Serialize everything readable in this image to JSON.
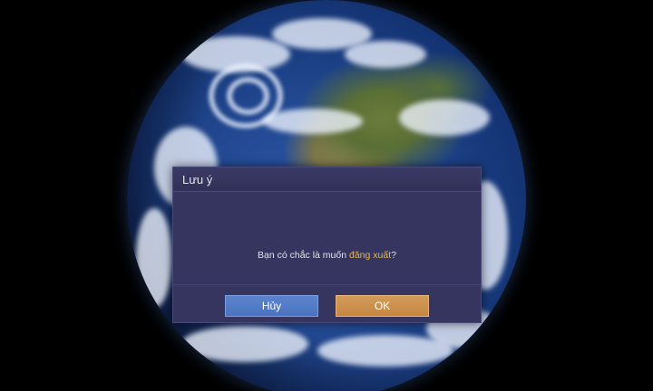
{
  "dialog": {
    "title": "Lưu ý",
    "message_prefix": "Bạn có chắc là muốn ",
    "message_highlight": "đăng xuất",
    "message_suffix": "?",
    "cancel_label": "Hủy",
    "ok_label": "OK"
  },
  "colors": {
    "dialog_bg": "#35355f",
    "highlight": "#e8b64a",
    "cancel_button": "#5b84cf",
    "ok_button": "#d39b58"
  }
}
